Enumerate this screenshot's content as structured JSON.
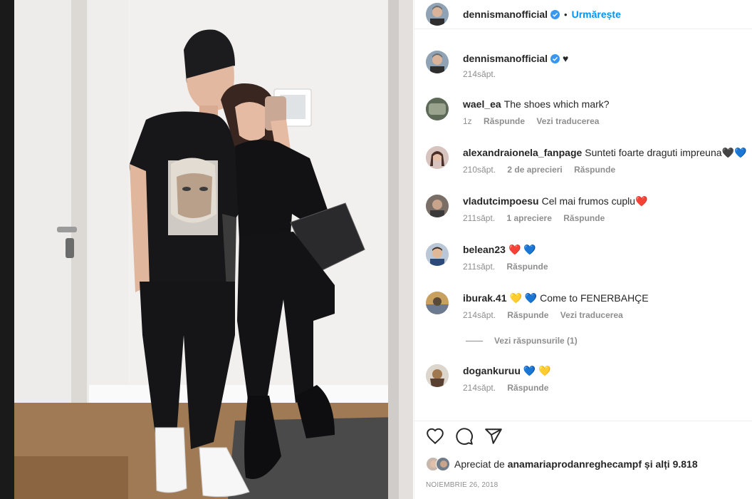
{
  "post": {
    "username": "dennismanofficial",
    "separator": "•",
    "follow_label": "Urmărește",
    "caption_suffix": "♥",
    "caption_time": "214săpt."
  },
  "comments": [
    {
      "user": "wael_ea",
      "text": "The shoes which mark?",
      "emoji": "",
      "time": "1z",
      "likes": "",
      "reply": "Răspunde",
      "translate": "Vezi traducerea"
    },
    {
      "user": "alexandraionela_fanpage",
      "text": "Sunteti foarte draguti impreuna",
      "emoji": "🖤💙",
      "time": "210săpt.",
      "likes": "2 de aprecieri",
      "reply": "Răspunde",
      "translate": ""
    },
    {
      "user": "vladutcimpoesu",
      "text": "Cel mai frumos cuplu",
      "emoji": "❤️",
      "time": "211săpt.",
      "likes": "1 apreciere",
      "reply": "Răspunde",
      "translate": ""
    },
    {
      "user": "belean23",
      "text": "",
      "emoji": "❤️ 💙",
      "time": "211săpt.",
      "likes": "",
      "reply": "Răspunde",
      "translate": ""
    },
    {
      "user": "iburak.41",
      "text": "Come to FENERBAHÇE",
      "emoji": "💛 💙",
      "time": "214săpt.",
      "likes": "",
      "reply": "Răspunde",
      "translate": "Vezi traducerea"
    },
    {
      "user": "dogankuruu",
      "text": "",
      "emoji": "💙 💛",
      "time": "214săpt.",
      "likes": "",
      "reply": "Răspunde",
      "translate": ""
    }
  ],
  "view_replies_label": "Vezi răspunsurile (1)",
  "likes": {
    "prefix": "Apreciat de",
    "user": "anamariaprodanreghecampf",
    "suffix": "și alți 9.818"
  },
  "date": "NOIEMBRIE 26, 2018",
  "colors": {
    "link": "#0095f6",
    "muted": "#8e8e8e",
    "text": "#262626",
    "verified": "#3897f0"
  },
  "icons": [
    "heart-icon",
    "comment-icon",
    "share-icon",
    "verified-icon"
  ]
}
